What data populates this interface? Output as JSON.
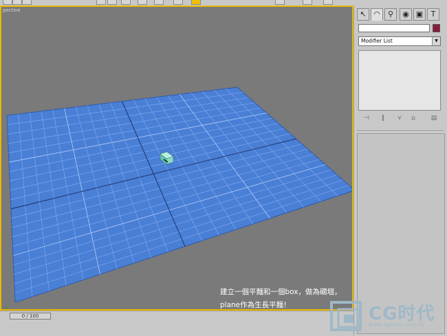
{
  "viewport": {
    "label": "pective",
    "caption_line1": "建立一個平麵和一個box，做為礀堌，",
    "caption_line2": "plane作為生長平麵！"
  },
  "command_panel": {
    "tabs": [
      "create-tab",
      "modify-tab",
      "hierarchy-tab",
      "motion-tab",
      "display-tab",
      "utilities-tab"
    ],
    "object_name": "",
    "object_color": "#8a1a3a",
    "modifier_list_label": "Modifier List"
  },
  "timeline": {
    "frame_indicator": "0 / 100"
  },
  "watermark": {
    "logo_text": "CG时代",
    "url": "www.cgtime.com.cn"
  },
  "colors": {
    "plane": "#4a7fd6",
    "grid_line": "#87aef0",
    "viewport_bg": "#7a7a7a",
    "active_border": "#e9b800",
    "box": "#7fd8c0"
  }
}
